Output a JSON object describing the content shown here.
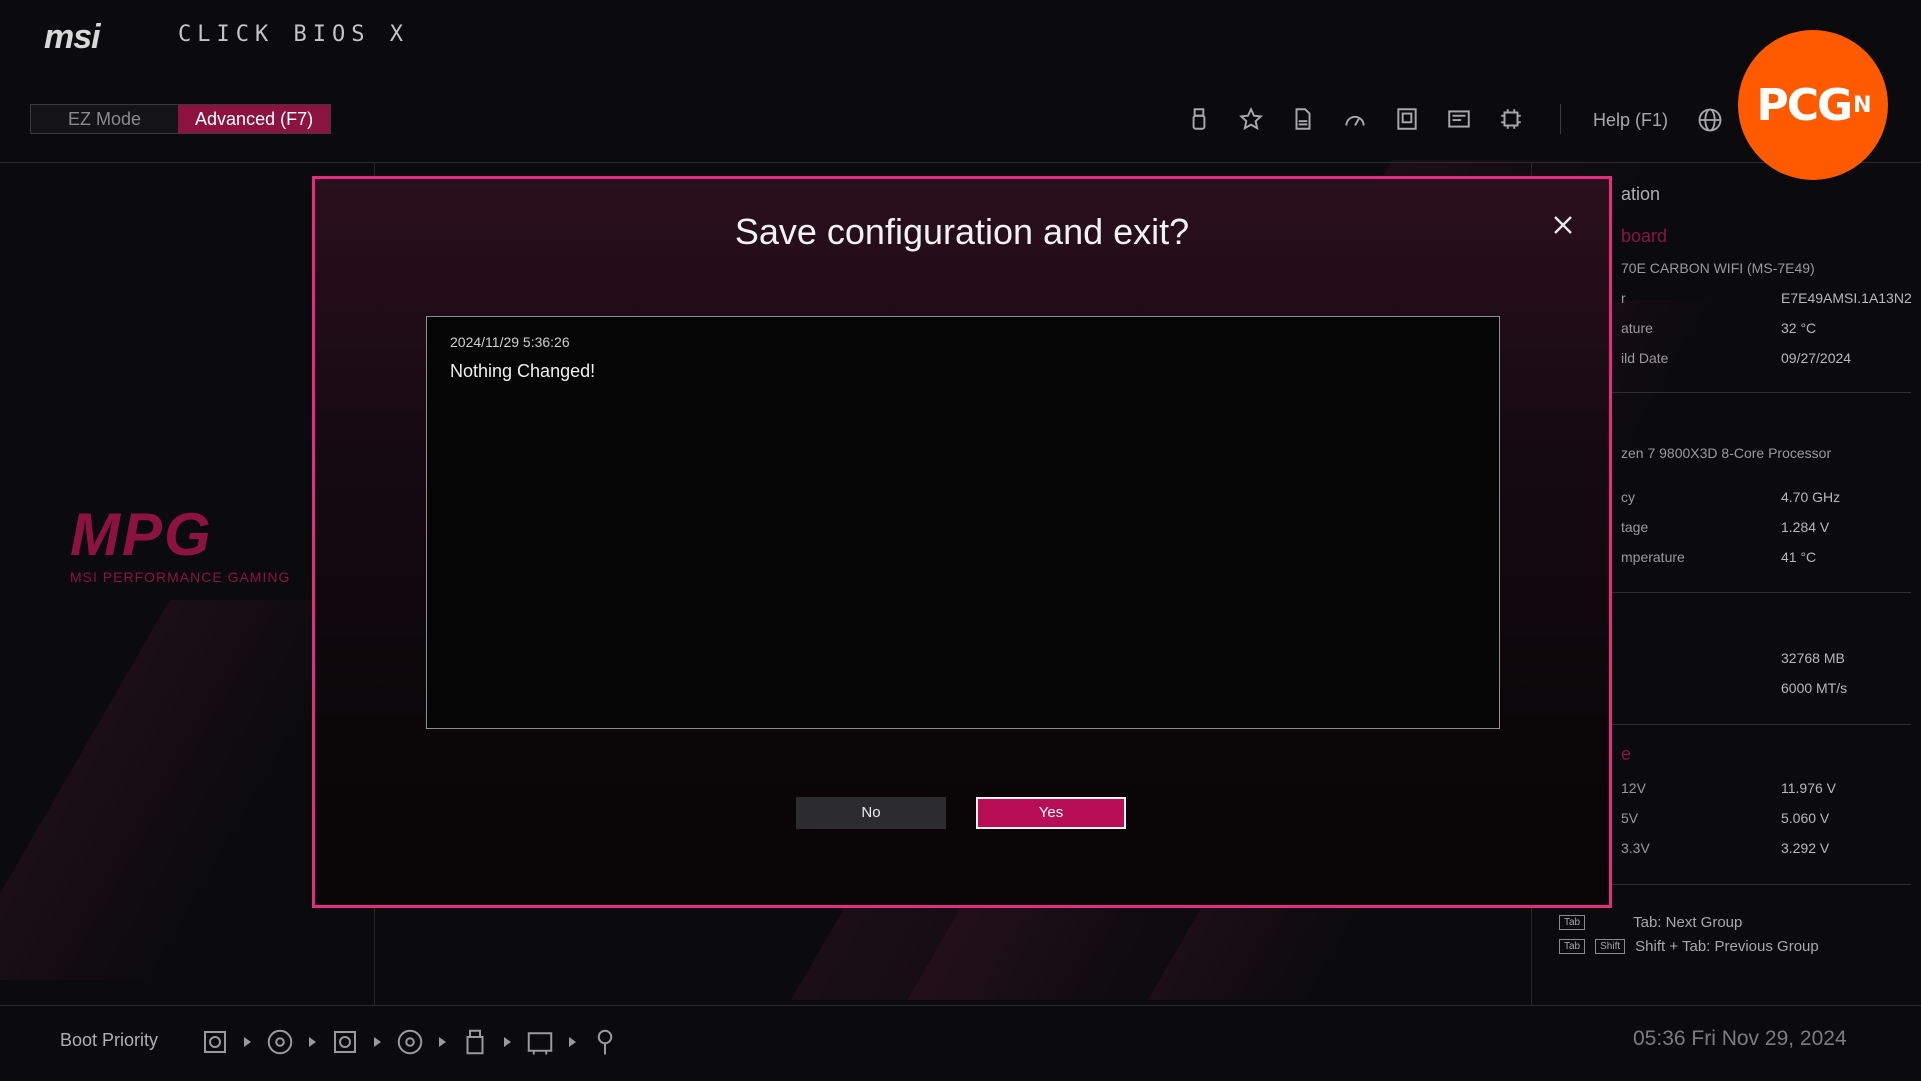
{
  "brand": {
    "logo": "msi",
    "title": "CLICK BIOS X"
  },
  "modes": {
    "ez": "EZ Mode",
    "advanced": "Advanced (F7)"
  },
  "toolbar": {
    "icons": [
      "usb-icon",
      "favorites-icon",
      "document-icon",
      "performance-icon",
      "hardware-monitor-icon",
      "board-explorer-icon",
      "cpu-icon"
    ],
    "help_label": "Help (F1)"
  },
  "watermark": {
    "text": "PCG",
    "superscript": "N"
  },
  "mpg": {
    "mark": "MPG",
    "sub": "MSI PERFORMANCE GAMING"
  },
  "side": {
    "heading": "ation",
    "board_label": "board",
    "board_name": "70E CARBON WIFI (MS-7E49)",
    "board_rows": [
      {
        "k": "r",
        "v": "E7E49AMSI.1A13N2"
      },
      {
        "k": "ature",
        "v": "32 °C"
      },
      {
        "k": "ild Date",
        "v": "09/27/2024"
      }
    ],
    "cpu_name": "zen 7 9800X3D 8-Core Processor",
    "cpu_rows": [
      {
        "k": "cy",
        "v": "4.70 GHz"
      },
      {
        "k": "tage",
        "v": "1.284 V"
      },
      {
        "k": "mperature",
        "v": "41 °C"
      }
    ],
    "mem_rows": [
      {
        "k": "",
        "v": "32768 MB"
      },
      {
        "k": "",
        "v": "6000 MT/s"
      }
    ],
    "volt_label": "e",
    "volt_rows": [
      {
        "k": "12V",
        "v": "11.976 V"
      },
      {
        "k": "5V",
        "v": "5.060 V"
      },
      {
        "k": "3.3V",
        "v": "3.292 V"
      }
    ],
    "hint1_key": "Tab",
    "hint1": "Tab: Next Group",
    "hint2_key1": "Tab",
    "hint2_key2": "Shift",
    "hint2": "Shift + Tab: Previous Group"
  },
  "bottom": {
    "boot_label": "Boot Priority",
    "boot_devices": [
      "hdd-icon",
      "optical-disc-icon",
      "hdd-icon",
      "optical-disc-icon",
      "usb-drive-icon",
      "network-card-icon",
      "usb-key-icon"
    ],
    "clock": "05:36  Fri Nov 29, 2024"
  },
  "dialog": {
    "title": "Save configuration and exit?",
    "log_time": "2024/11/29 5:36:26",
    "log_message": "Nothing Changed!",
    "no_label": "No",
    "yes_label": "Yes"
  },
  "colors": {
    "accent": "#e62c80",
    "brand_red": "#8c1340",
    "yes_button": "#b80e55",
    "badge": "#ff5a00"
  }
}
